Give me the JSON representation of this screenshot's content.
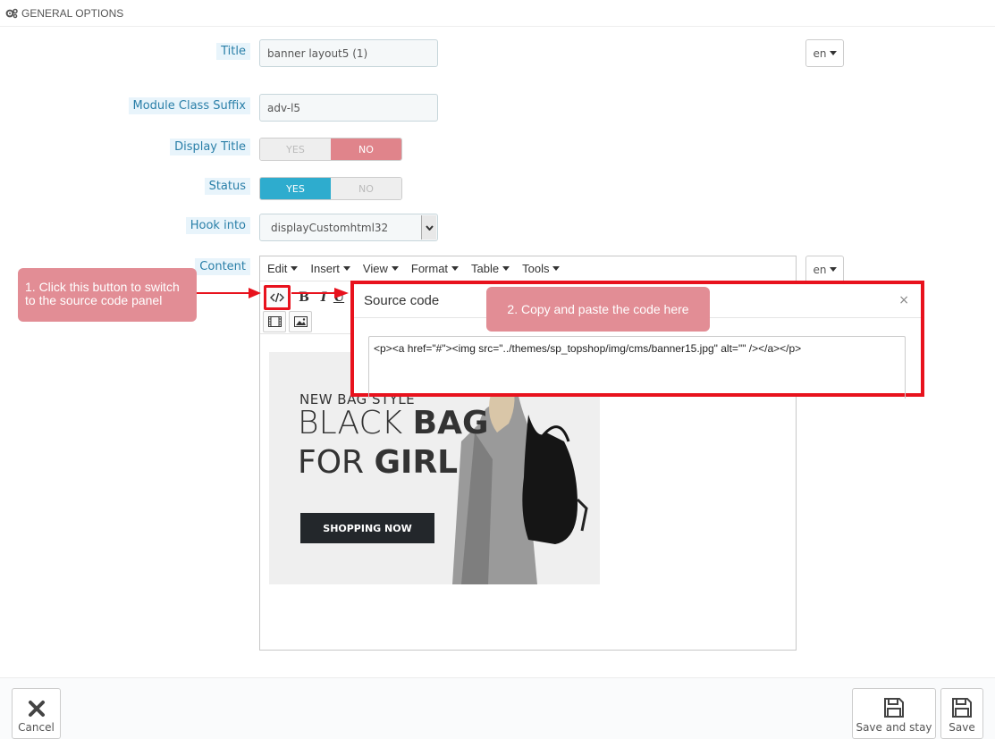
{
  "panel": {
    "heading": "GENERAL OPTIONS"
  },
  "form": {
    "title_label": "Title",
    "title_value": "banner layout5 (1)",
    "lang": "en",
    "suffix_label": "Module Class Suffix",
    "suffix_value": "adv-l5",
    "display_title_label": "Display Title",
    "display_title": {
      "yes": "YES",
      "no": "NO",
      "selected": "NO"
    },
    "status_label": "Status",
    "status": {
      "yes": "YES",
      "no": "NO",
      "selected": "YES"
    },
    "hook_label": "Hook into",
    "hook_value": "displayCustomhtml32",
    "content_label": "Content",
    "content_lang": "en"
  },
  "editor": {
    "menus": [
      "Edit",
      "Insert",
      "View",
      "Format",
      "Table",
      "Tools"
    ],
    "toolbar": {
      "bold": "B",
      "italic": "I",
      "underline": "U"
    },
    "banner": {
      "kicker": "NEW BAG STYLE",
      "line1_light": "BLACK ",
      "line1_bold": "BAG",
      "line2_light": "FOR ",
      "line2_bold": "GIRL",
      "cta": "SHOPPING NOW"
    }
  },
  "annotations": {
    "step1": "1. Click this button to switch to the source code panel",
    "step2": "2. Copy and paste the code here"
  },
  "modal": {
    "title": "Source code",
    "close": "×",
    "code": "<p><a href=\"#\"><img src=\"../themes/sp_topshop/img/cms/banner15.jpg\" alt=\"\" /></a></p>"
  },
  "footer": {
    "cancel": "Cancel",
    "save_and_stay": "Save and stay",
    "save": "Save"
  },
  "colors": {
    "label_blue": "#2a7fa8",
    "label_bg": "#e8f4fb",
    "no_active": "#e0848b",
    "yes_active": "#2eacce",
    "callout": "#e28d95",
    "highlight_red": "#e8121d"
  }
}
